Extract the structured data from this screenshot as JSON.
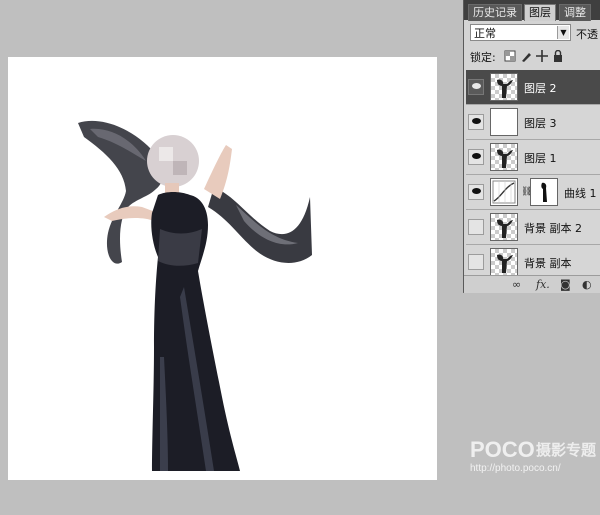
{
  "panel": {
    "tabs": [
      "历史记录",
      "图层",
      "调整"
    ],
    "active_tab": 1,
    "blend_mode": "正常",
    "opacity_label": "不透",
    "lock_label": "锁定:",
    "layers": [
      {
        "name": "图层 2",
        "visible": true,
        "selected": true,
        "thumb": "figure"
      },
      {
        "name": "图层 3",
        "visible": true,
        "selected": false,
        "thumb": "blank"
      },
      {
        "name": "图层 1",
        "visible": true,
        "selected": false,
        "thumb": "figure"
      },
      {
        "name": "曲线 1",
        "visible": true,
        "selected": false,
        "thumb": "curves"
      },
      {
        "name": "背景 副本 2",
        "visible": false,
        "selected": false,
        "thumb": "figure"
      },
      {
        "name": "背景 副本",
        "visible": false,
        "selected": false,
        "thumb": "figure"
      }
    ]
  },
  "watermark": {
    "logo": "POCO",
    "slogan": "摄影专题",
    "url": "http://photo.poco.cn/"
  }
}
